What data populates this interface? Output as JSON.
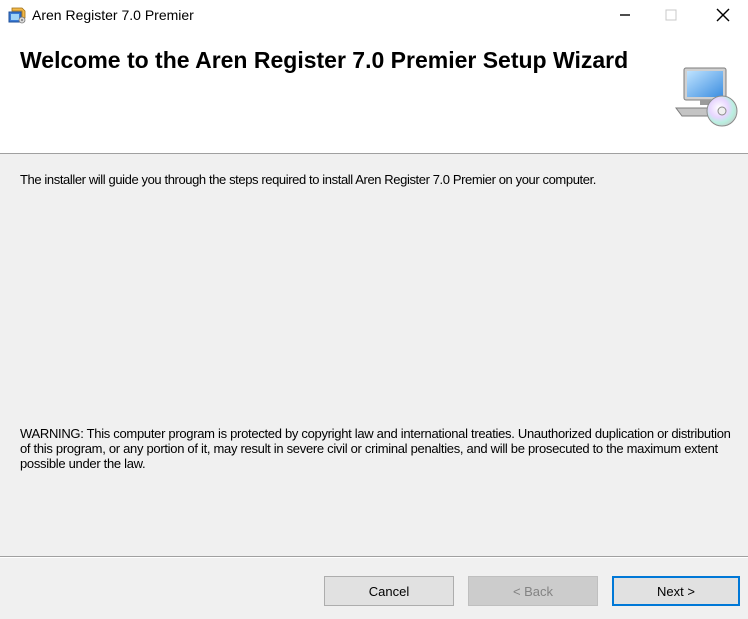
{
  "window": {
    "title": "Aren Register 7.0 Premier",
    "app_icon": "installer-icon",
    "controls": {
      "minimize": "—",
      "maximize": "☐",
      "close": "✕"
    }
  },
  "banner": {
    "title": "Welcome to the Aren Register 7.0 Premier Setup Wizard",
    "icon": "computer-cd-icon"
  },
  "content": {
    "intro": "The installer will guide you through the steps required to install Aren Register 7.0 Premier on your computer.",
    "warning": "WARNING: This computer program is protected by copyright law and international treaties. Unauthorized duplication or distribution of this program, or any portion of it, may result in severe civil or criminal penalties, and will be prosecuted to the maximum extent possible under the law."
  },
  "buttons": {
    "cancel": "Cancel",
    "back": "< Back",
    "next": "Next >"
  },
  "colors": {
    "accent": "#0078d7",
    "panel": "#f0f0f0",
    "disabled_text": "#838383"
  }
}
